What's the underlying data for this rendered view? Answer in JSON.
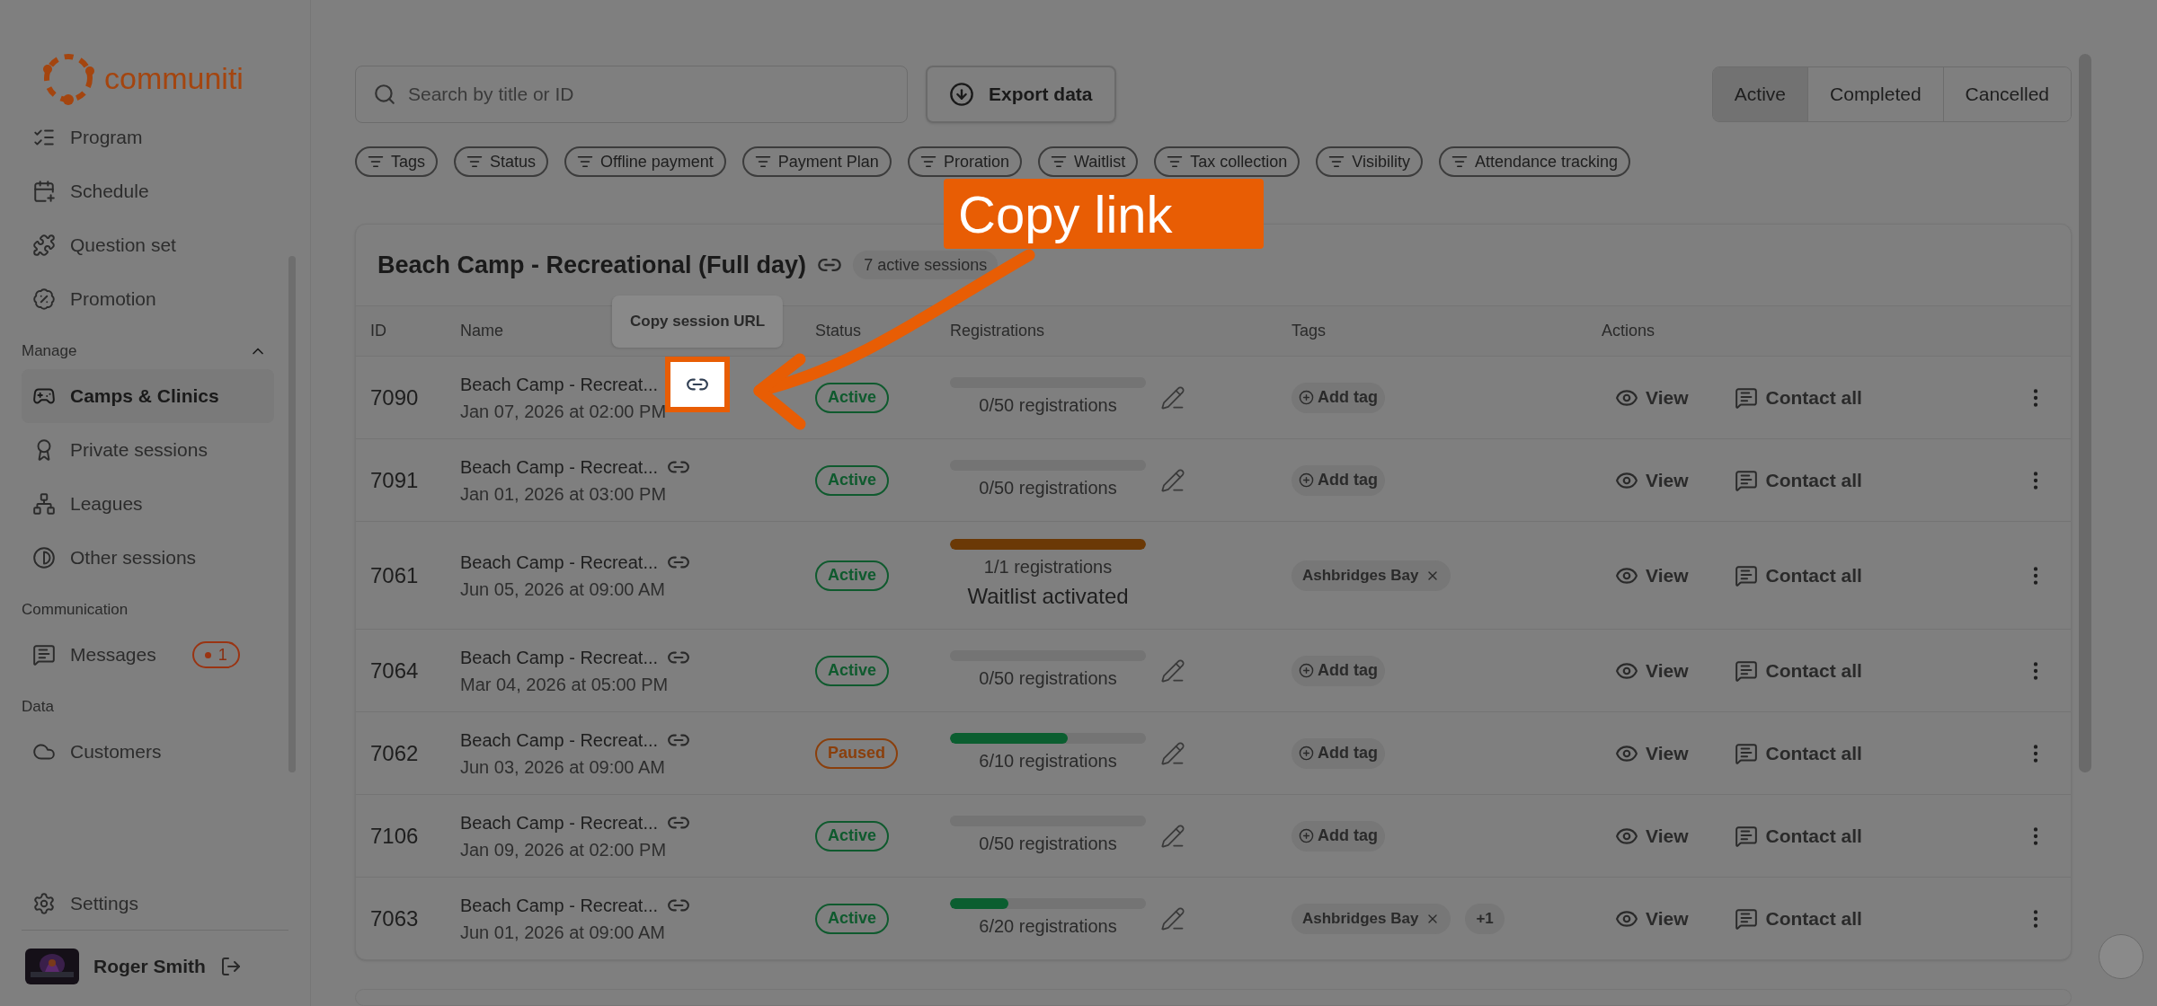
{
  "brand": {
    "name": "communiti"
  },
  "sidebar": {
    "items": [
      {
        "label": "Program",
        "selected": false
      },
      {
        "label": "Schedule",
        "selected": false
      },
      {
        "label": "Question set",
        "selected": false
      },
      {
        "label": "Promotion",
        "selected": false
      }
    ],
    "sections": [
      {
        "title": "Manage",
        "expanded": true,
        "items": [
          {
            "label": "Camps & Clinics",
            "selected": true
          },
          {
            "label": "Private sessions",
            "selected": false
          },
          {
            "label": "Leagues",
            "selected": false
          },
          {
            "label": "Other sessions",
            "selected": false
          }
        ]
      },
      {
        "title": "Communication",
        "items": [
          {
            "label": "Messages",
            "selected": false,
            "badge": "1"
          }
        ]
      },
      {
        "title": "Data",
        "items": [
          {
            "label": "Customers",
            "selected": false
          }
        ]
      }
    ],
    "settings": "Settings",
    "user": {
      "name": "Roger Smith"
    }
  },
  "search": {
    "placeholder": "Search by title or ID"
  },
  "export_button": "Export data",
  "status_tabs": [
    {
      "label": "Active",
      "selected": true
    },
    {
      "label": "Completed",
      "selected": false
    },
    {
      "label": "Cancelled",
      "selected": false
    }
  ],
  "filters": [
    "Tags",
    "Status",
    "Offline payment",
    "Payment Plan",
    "Proration",
    "Waitlist",
    "Tax collection",
    "Visibility",
    "Attendance tracking"
  ],
  "group": {
    "title": "Beach Camp - Recreational (Full day)",
    "badge": "7 active sessions",
    "columns": [
      "ID",
      "Name",
      "Status",
      "Registrations",
      "Tags",
      "Actions"
    ],
    "rows": [
      {
        "id": "7090",
        "name": "Beach Camp - Recreat...",
        "date": "Jan 07, 2026 at 02:00 PM",
        "link_highlighted": true,
        "tooltip": "Copy session URL",
        "status": {
          "kind": "active",
          "label": "Active"
        },
        "level": 0,
        "reading": "0/50 registrations",
        "add_tag": "Add tag",
        "actions": [
          "View",
          "Contact all"
        ]
      },
      {
        "id": "7091",
        "name": "Beach Camp - Recreat...",
        "date": "Jan 01, 2026 at 03:00 PM",
        "link_highlighted": false,
        "status": {
          "kind": "active",
          "label": "Active"
        },
        "level": 0,
        "reading": "0/50 registrations",
        "add_tag": "Add tag",
        "actions": [
          "View",
          "Contact all"
        ]
      },
      {
        "id": "7061",
        "name": "Beach Camp - Recreat...",
        "date": "Jun 05, 2026 at 09:00 AM",
        "link_highlighted": false,
        "status": {
          "kind": "active",
          "label": "Active"
        },
        "level": 1,
        "color": "#6b3906",
        "reading": "1/1 registrations",
        "note": "Waitlist activated",
        "tags": [
          "Ashbridges Bay"
        ],
        "actions": [
          "View",
          "Contact all"
        ]
      },
      {
        "id": "7064",
        "name": "Beach Camp - Recreat...",
        "date": "Mar 04, 2026 at 05:00 PM",
        "link_highlighted": false,
        "status": {
          "kind": "active",
          "label": "Active"
        },
        "level": 0,
        "reading": "0/50 registrations",
        "add_tag": "Add tag",
        "actions": [
          "View",
          "Contact all"
        ]
      },
      {
        "id": "7062",
        "name": "Beach Camp - Recreat...",
        "date": "Jun 03, 2026 at 09:00 AM",
        "link_highlighted": false,
        "status": {
          "kind": "paused",
          "label": "Paused"
        },
        "level": 0.6,
        "color": "#0b5e30",
        "reading": "6/10 registrations",
        "add_tag": "Add tag",
        "actions": [
          "View",
          "Contact all"
        ]
      },
      {
        "id": "7106",
        "name": "Beach Camp - Recreat...",
        "date": "Jan 09, 2026 at 02:00 PM",
        "link_highlighted": false,
        "status": {
          "kind": "active",
          "label": "Active"
        },
        "level": 0,
        "reading": "0/50 registrations",
        "add_tag": "Add tag",
        "actions": [
          "View",
          "Contact all"
        ]
      },
      {
        "id": "7063",
        "name": "Beach Camp - Recreat...",
        "date": "Jun 01, 2026 at 09:00 AM",
        "link_highlighted": false,
        "status": {
          "kind": "active",
          "label": "Active"
        },
        "level": 0.3,
        "color": "#0b5e30",
        "reading": "6/20 registrations",
        "tags": [
          "Ashbridges Bay"
        ],
        "more_tags": "+1",
        "actions": [
          "View",
          "Contact all"
        ]
      }
    ]
  },
  "annotation": {
    "callout": "Copy link"
  }
}
